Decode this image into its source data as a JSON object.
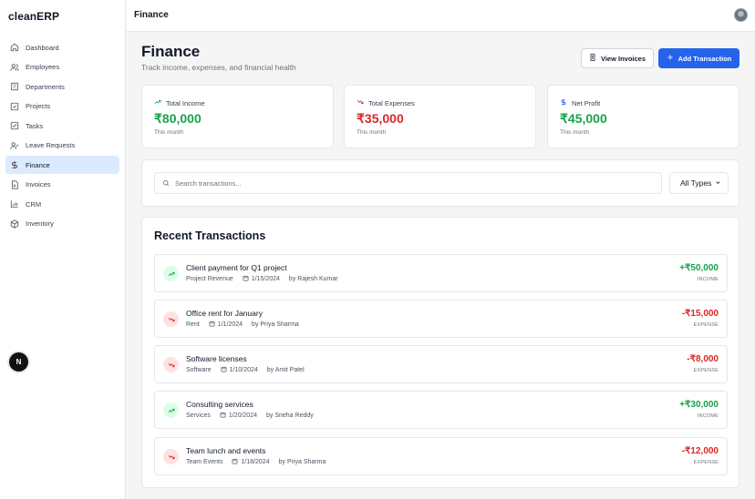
{
  "app": {
    "brand": "cleanERP"
  },
  "sidebar": {
    "items": [
      {
        "label": "Dashboard",
        "icon": "dashboard-icon"
      },
      {
        "label": "Employees",
        "icon": "users-icon"
      },
      {
        "label": "Departments",
        "icon": "building-icon"
      },
      {
        "label": "Projects",
        "icon": "projects-icon"
      },
      {
        "label": "Tasks",
        "icon": "tasks-icon"
      },
      {
        "label": "Leave Requests",
        "icon": "leave-icon"
      },
      {
        "label": "Finance",
        "icon": "dollar-icon",
        "active": true
      },
      {
        "label": "Invoices",
        "icon": "invoice-icon"
      },
      {
        "label": "CRM",
        "icon": "chart-icon"
      },
      {
        "label": "Inventory",
        "icon": "box-icon"
      }
    ],
    "badge": "N"
  },
  "header": {
    "title": "Finance"
  },
  "page": {
    "title": "Finance",
    "subtitle": "Track income, expenses, and financial health",
    "view_invoices_label": "View Invoices",
    "add_transaction_label": "Add Transaction"
  },
  "stats": [
    {
      "label": "Total Income",
      "value": "₹80,000",
      "caption": "This month",
      "color": "#16a34a"
    },
    {
      "label": "Total Expenses",
      "value": "₹35,000",
      "caption": "This month",
      "color": "#dc2626"
    },
    {
      "label": "Net Profit",
      "value": "₹45,000",
      "caption": "This month",
      "color": "#16a34a"
    }
  ],
  "filters": {
    "search_placeholder": "Search transactions...",
    "type_selected": "All Types"
  },
  "transactions": {
    "heading": "Recent Transactions",
    "rows": [
      {
        "description": "Client payment for Q1 project",
        "category": "Project Revenue",
        "date": "1/15/2024",
        "by": "by Rajesh Kumar",
        "amount": "+₹50,000",
        "type": "INCOME"
      },
      {
        "description": "Office rent for January",
        "category": "Rent",
        "date": "1/1/2024",
        "by": "by Priya Sharma",
        "amount": "-₹15,000",
        "type": "EXPENSE"
      },
      {
        "description": "Software licenses",
        "category": "Software",
        "date": "1/10/2024",
        "by": "by Amit Patel",
        "amount": "-₹8,000",
        "type": "EXPENSE"
      },
      {
        "description": "Consulting services",
        "category": "Services",
        "date": "1/20/2024",
        "by": "by Sneha Reddy",
        "amount": "+₹30,000",
        "type": "INCOME"
      },
      {
        "description": "Team lunch and events",
        "category": "Team Events",
        "date": "1/18/2024",
        "by": "by Priya Sharma",
        "amount": "-₹12,000",
        "type": "EXPENSE"
      }
    ]
  },
  "colors": {
    "accent": "#2563eb",
    "income": "#16a34a",
    "expense": "#dc2626",
    "active_nav": "#dbeafe"
  }
}
